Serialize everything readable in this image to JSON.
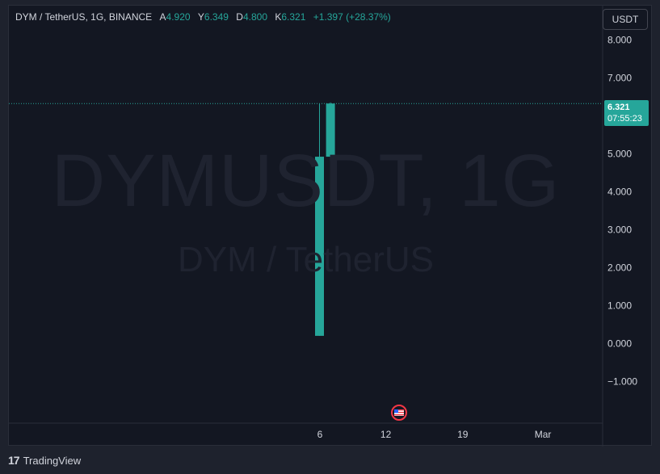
{
  "legend": {
    "symbol": "DYM / TetherUS, 1G, BINANCE",
    "open_label": "A",
    "open": "4.920",
    "high_label": "Y",
    "high": "6.349",
    "low_label": "D",
    "low": "4.800",
    "close_label": "K",
    "close": "6.321",
    "change": "+1.397 (+28.37%)"
  },
  "currency_button": "USDT",
  "watermark": {
    "main": "DYMUSDT, 1G",
    "sub": "DYM / TetherUS"
  },
  "price_tag": {
    "price": "6.321",
    "countdown": "07:55:23"
  },
  "footer": {
    "brand": "TradingView",
    "logo": "tv-logo-icon"
  },
  "colors": {
    "up": "#26a69a",
    "background": "#131722",
    "panel": "#1e222d"
  },
  "chart_data": {
    "type": "candlestick",
    "y_ticks": [
      "8.000",
      "7.000",
      "5.000",
      "4.000",
      "3.000",
      "2.000",
      "1.000",
      "0.000",
      "−1.000"
    ],
    "y_tick_values": [
      8,
      7,
      5,
      4,
      3,
      2,
      1,
      0,
      -1
    ],
    "x_ticks": [
      "6",
      "12",
      "19",
      "Mar"
    ],
    "ylim": [
      -2.1,
      8.9
    ],
    "current_price": 6.321,
    "candles": [
      {
        "day": 6,
        "open": 0.2,
        "high": 6.321,
        "low": 0.2,
        "close": 4.92
      },
      {
        "day": 7,
        "open": 4.92,
        "high": 6.349,
        "low": 4.8,
        "close": 6.321
      }
    ]
  }
}
